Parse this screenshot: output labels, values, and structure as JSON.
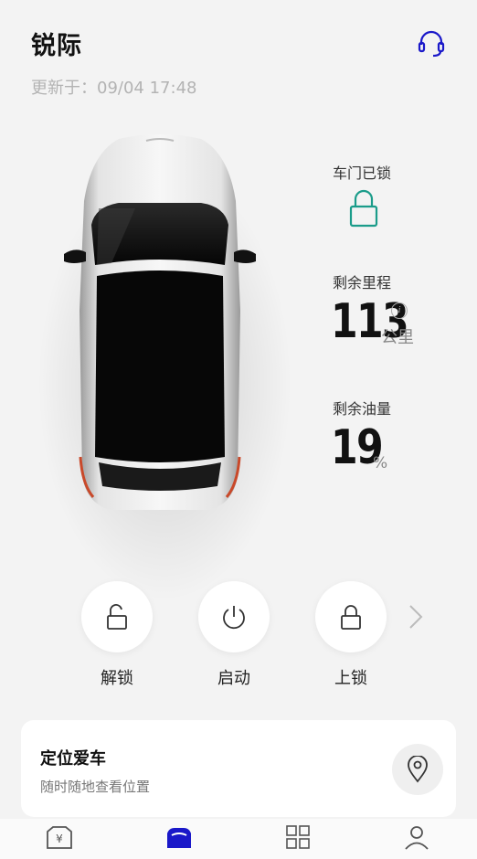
{
  "header": {
    "title": "锐际",
    "updated": "更新于：09/04 17:48"
  },
  "status": {
    "lock_label": "车门已锁",
    "mileage_label": "剩余里程",
    "mileage_value": "113",
    "mileage_unit": "公里",
    "fuel_label": "剩余油量",
    "fuel_value": "19",
    "fuel_unit": "%"
  },
  "actions": [
    {
      "label": "解锁",
      "icon": "unlock-icon"
    },
    {
      "label": "启动",
      "icon": "power-icon"
    },
    {
      "label": "上锁",
      "icon": "lock-icon"
    }
  ],
  "locate": {
    "title": "定位爱车",
    "subtitle": "随时随地查看位置"
  },
  "tabs": [
    {
      "icon": "store-icon",
      "active": false
    },
    {
      "icon": "car-icon",
      "active": true
    },
    {
      "icon": "apps-grid-icon",
      "active": false
    },
    {
      "icon": "profile-icon",
      "active": false
    }
  ],
  "colors": {
    "accent": "#1a18c9",
    "lock_green": "#1b9c8a",
    "background": "#f3f3f3"
  }
}
